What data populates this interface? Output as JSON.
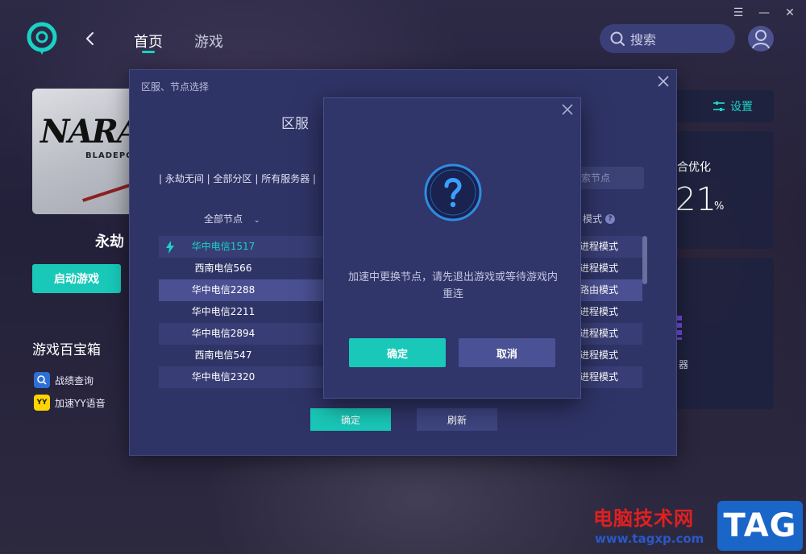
{
  "header": {
    "nav_home": "首页",
    "nav_games": "游戏",
    "search_placeholder": "搜索"
  },
  "game": {
    "cover_title": "NARA",
    "cover_subtitle": "BLADEPOI",
    "name": "永劫",
    "start_label": "启动游戏"
  },
  "toolbox": {
    "title": "游戏百宝箱",
    "items": [
      {
        "label": "战绩查询",
        "icon": "search-icon"
      },
      {
        "label": "加速YY语音",
        "icon": "yy-icon",
        "icon_text": "YY"
      }
    ]
  },
  "right_panel": {
    "settings_label": "设置",
    "optimize_label": "合优化",
    "optimize_value": "21",
    "optimize_unit": "%",
    "accel_text": "器"
  },
  "node_dialog": {
    "title": "区服、节点选择",
    "region_label": "区服",
    "filters": "| 永劫无间 | 全部分区 | 所有服务器 |",
    "search_placeholder": "索节点",
    "col_nodes": "全部节点",
    "col_mode": "模式",
    "rows": [
      {
        "name": "华中电信1517",
        "mode": "进程模式"
      },
      {
        "name": "西南电信566",
        "mode": "进程模式"
      },
      {
        "name": "华中电信2288",
        "mode": "路由模式"
      },
      {
        "name": "华中电信2211",
        "mode": "进程模式"
      },
      {
        "name": "华中电信2894",
        "mode": "进程模式"
      },
      {
        "name": "西南电信547",
        "mode": "进程模式"
      },
      {
        "name": "华中电信2320",
        "mode": "进程模式"
      }
    ],
    "ok_label": "确定",
    "refresh_label": "刷新"
  },
  "confirm_dialog": {
    "message": "加速中更换节点，请先退出游戏或等待游戏内重连",
    "ok_label": "确定",
    "cancel_label": "取消"
  },
  "watermark": {
    "text": "电脑技术网",
    "url": "www.tagxp.com",
    "tag": "TAG"
  },
  "colors": {
    "accent": "#19c8b8",
    "dialog_bg": "#2f3467",
    "watermark_red": "#e02020",
    "watermark_blue": "#1a66c8"
  }
}
